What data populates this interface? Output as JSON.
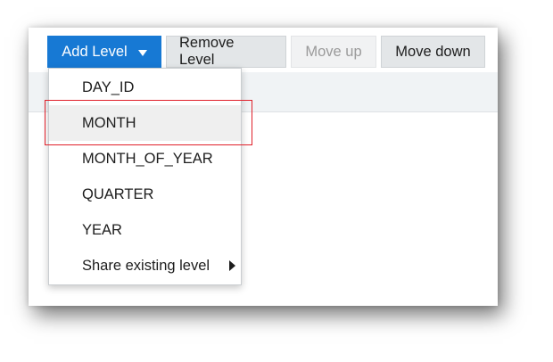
{
  "toolbar": {
    "add_level_label": "Add Level",
    "remove_level_label": "Remove Level",
    "move_up_label": "Move up",
    "move_down_label": "Move down"
  },
  "menu": {
    "items": [
      {
        "label": "DAY_ID"
      },
      {
        "label": "MONTH"
      },
      {
        "label": "MONTH_OF_YEAR"
      },
      {
        "label": "QUARTER"
      },
      {
        "label": "YEAR"
      },
      {
        "label": "Share existing level"
      }
    ],
    "highlighted_item": "MONTH"
  },
  "colors": {
    "primary": "#1779d4",
    "highlight_outline": "#e0202a",
    "hover_row": "#efefef"
  },
  "icons": {
    "dropdown_caret": "caret-down-icon",
    "submenu_arrow": "chevron-right-icon"
  }
}
